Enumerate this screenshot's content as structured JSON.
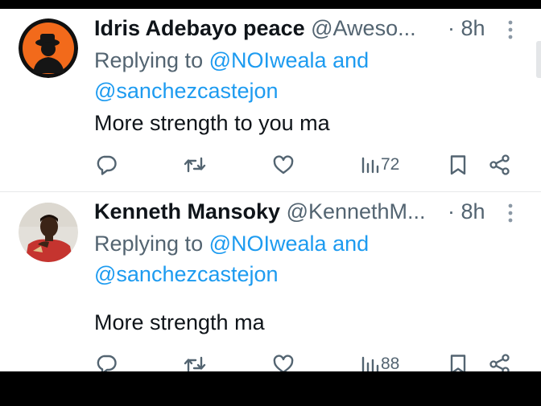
{
  "colors": {
    "accent": "#1d9bf0",
    "text_primary": "#0f1419",
    "text_secondary": "#536471",
    "icon_gray": "#536471"
  },
  "replies": [
    {
      "name": "Idris Adebayo peace",
      "handle": "@Aweso...",
      "time": "· 8h",
      "replying_label": "Replying to",
      "mention1": "@NOIweala",
      "and_label": "and",
      "mention2": "@sanchezcastejon",
      "text": "More strength to you ma",
      "views": "72",
      "avatar": "orange-background-silhouette-avatar",
      "icons": [
        "reply-icon",
        "repost-icon",
        "like-icon",
        "views-icon",
        "bookmark-icon",
        "share-icon",
        "more-icon"
      ]
    },
    {
      "name": "Kenneth Mansoky",
      "handle": "@KennethM...",
      "time": "· 8h",
      "replying_label": "Replying to",
      "mention1": "@NOIweala",
      "and_label": "and",
      "mention2": "@sanchezcastejon",
      "text": "More strength ma",
      "views": "88",
      "avatar": "photo-avatar",
      "icons": [
        "reply-icon",
        "repost-icon",
        "like-icon",
        "views-icon",
        "bookmark-icon",
        "share-icon",
        "more-icon"
      ]
    }
  ]
}
